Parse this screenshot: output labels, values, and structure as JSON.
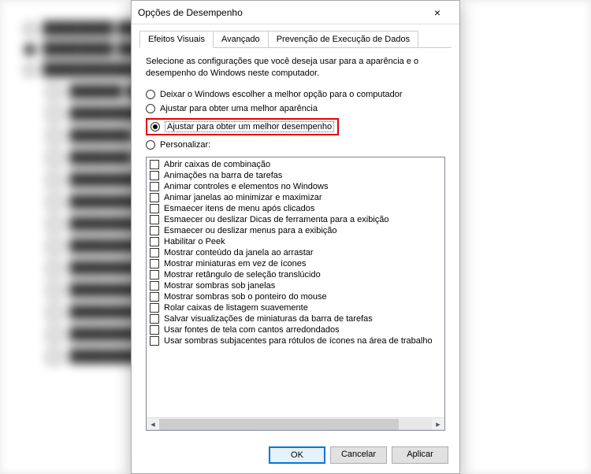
{
  "dialog": {
    "title": "Opções de Desempenho",
    "close_icon": "×"
  },
  "tabs": [
    {
      "label": "Efeitos Visuais",
      "active": true
    },
    {
      "label": "Avançado",
      "active": false
    },
    {
      "label": "Prevenção de Execução de Dados",
      "active": false
    }
  ],
  "intro": "Selecione as configurações que você deseja usar para a aparência e o desempenho do Windows neste computador.",
  "radios": [
    {
      "label": "Deixar o Windows escolher a melhor opção para o computador",
      "selected": false,
      "highlighted": false
    },
    {
      "label": "Ajustar para obter uma melhor aparência",
      "selected": false,
      "highlighted": false
    },
    {
      "label": "Ajustar para obter um melhor desempenho",
      "selected": true,
      "highlighted": true
    },
    {
      "label": "Personalizar:",
      "selected": false,
      "highlighted": false
    }
  ],
  "checks": [
    "Abrir caixas de combinação",
    "Animações na barra de tarefas",
    "Animar controles e elementos no Windows",
    "Animar janelas ao minimizar e maximizar",
    "Esmaecer itens de menu após clicados",
    "Esmaecer ou deslizar Dicas de ferramenta para a exibição",
    "Esmaecer ou deslizar menus para a exibição",
    "Habilitar o Peek",
    "Mostrar conteúdo da janela ao arrastar",
    "Mostrar miniaturas em vez de ícones",
    "Mostrar retângulo de seleção translúcido",
    "Mostrar sombras sob janelas",
    "Mostrar sombras sob o ponteiro do mouse",
    "Rolar caixas de listagem suavemente",
    "Salvar visualizações de miniaturas da barra de tarefas",
    "Usar fontes de tela com cantos arredondados",
    "Usar sombras subjacentes para rótulos de ícones na área de trabalho"
  ],
  "buttons": {
    "ok": "OK",
    "cancel": "Cancelar",
    "apply": "Aplicar"
  },
  "scroll": {
    "left": "◄",
    "right": "►"
  }
}
